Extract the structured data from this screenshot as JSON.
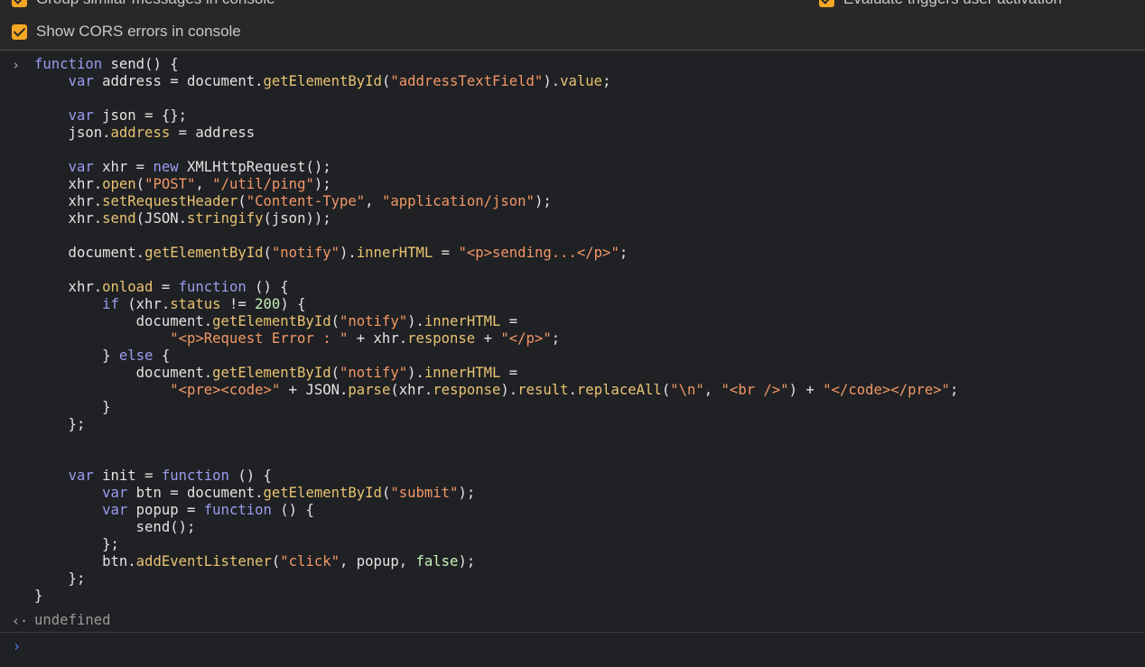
{
  "settings": {
    "group_similar": {
      "label": "Group similar messages in console",
      "checked": true
    },
    "evaluate_triggers": {
      "label": "Evaluate triggers user activation",
      "checked": true
    },
    "show_cors": {
      "label": "Show CORS errors in console",
      "checked": true
    }
  },
  "console": {
    "input_glyph": "›",
    "code": [
      "function send() {",
      "    var address = document.getElementById(\"addressTextField\").value;",
      "",
      "    var json = {};",
      "    json.address = address",
      "",
      "    var xhr = new XMLHttpRequest();",
      "    xhr.open(\"POST\", \"/util/ping\");",
      "    xhr.setRequestHeader(\"Content-Type\", \"application/json\");",
      "    xhr.send(JSON.stringify(json));",
      "",
      "    document.getElementById(\"notify\").innerHTML = \"<p>sending...</p>\";",
      "",
      "    xhr.onload = function () {",
      "        if (xhr.status != 200) {",
      "            document.getElementById(\"notify\").innerHTML =",
      "                \"<p>Request Error : \" + xhr.response + \"</p>\";",
      "        } else {",
      "            document.getElementById(\"notify\").innerHTML =",
      "                \"<pre><code>\" + JSON.parse(xhr.response).result.replaceAll(\"\\n\", \"<br />\") + \"</code></pre>\";",
      "        }",
      "    };",
      "",
      "",
      "    var init = function () {",
      "        var btn = document.getElementById(\"submit\");",
      "        var popup = function () {",
      "            send();",
      "        };",
      "        btn.addEventListener(\"click\", popup, false);",
      "    };",
      "}"
    ],
    "result_glyph": "‹·",
    "result_text": "undefined",
    "prompt_glyph": "›",
    "prompt_value": ""
  }
}
